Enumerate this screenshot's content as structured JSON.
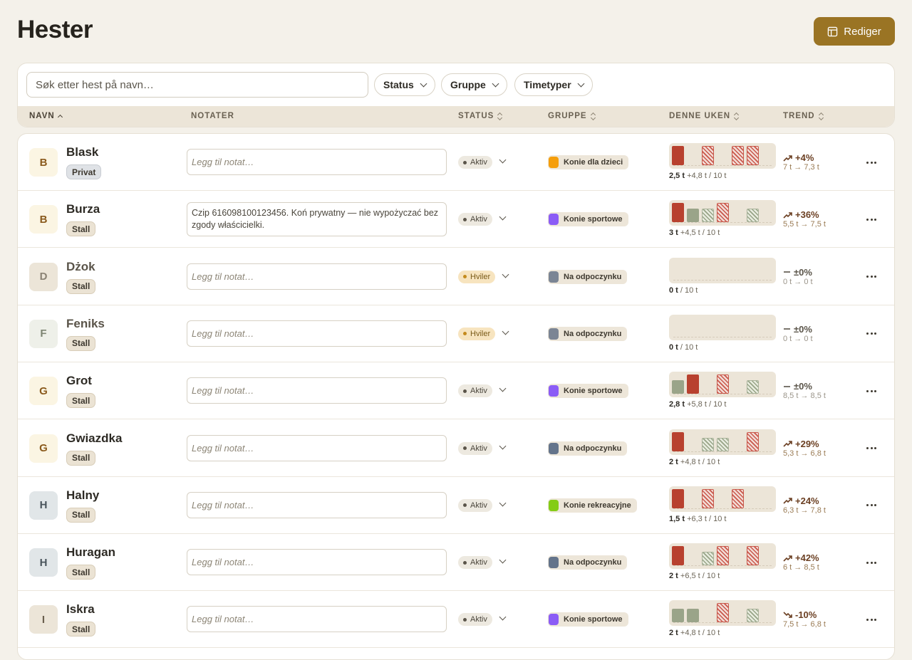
{
  "header": {
    "title": "Hester",
    "edit_label": "Rediger"
  },
  "filters": {
    "search_placeholder": "Søk etter hest på navn…",
    "status_label": "Status",
    "group_label": "Gruppe",
    "lesson_types_label": "Timetyper"
  },
  "table": {
    "columns": {
      "name": "NAVN",
      "notes": "NOTATER",
      "status": "STATUS",
      "group": "GRUPPE",
      "week": "DENNE UKEN",
      "trend": "TREND"
    },
    "note_placeholder": "Legg til notat…",
    "rows": [
      {
        "initial": "B",
        "name": "Blask",
        "tag": "Privat",
        "note": "",
        "status": "Aktiv",
        "group": "Konie dla dzieci",
        "group_color": "#f59e0b",
        "week_hours": "2,5 t",
        "week_extra": "+4,8 t",
        "week_cap": "/ 10 t",
        "trend": "+4%",
        "trend_range": "7 t → 7,3 t",
        "bars": [
          "solid",
          "",
          "plan",
          "",
          "plan",
          "plan"
        ],
        "trend_dir": "up"
      },
      {
        "initial": "B",
        "name": "Burza",
        "tag": "Stall",
        "note": "Czip 616098100123456. Koń prywatny — nie wypożyczać bez zgody właścicielki.",
        "status": "Aktiv",
        "group": "Konie sportowe",
        "group_color": "#8b5cf6",
        "week_hours": "3 t",
        "week_extra": "+4,5 t",
        "week_cap": "/ 10 t",
        "trend": "+36%",
        "trend_range": "5,5 t → 7,5 t",
        "bars": [
          "solid",
          "done",
          "plang",
          "plan",
          "",
          "plang"
        ],
        "trend_dir": "up"
      },
      {
        "initial": "D",
        "name": "Dżok",
        "tag": "Stall",
        "note": "",
        "status": "Hviler",
        "group": "Na odpoczynku",
        "group_color": "#7b8594",
        "week_hours": "0 t",
        "week_extra": "",
        "week_cap": "/ 10 t",
        "trend": "±0%",
        "trend_range": "0 t → 0 t",
        "bars": [
          "",
          "",
          "",
          "",
          "",
          ""
        ],
        "trend_dir": "flat"
      },
      {
        "initial": "F",
        "name": "Feniks",
        "tag": "Stall",
        "note": "",
        "status": "Hviler",
        "group": "Na odpoczynku",
        "group_color": "#7b8594",
        "week_hours": "0 t",
        "week_extra": "",
        "week_cap": "/ 10 t",
        "trend": "±0%",
        "trend_range": "0 t → 0 t",
        "bars": [
          "",
          "",
          "",
          "",
          "",
          ""
        ],
        "trend_dir": "flat"
      },
      {
        "initial": "G",
        "name": "Grot",
        "tag": "Stall",
        "note": "",
        "status": "Aktiv",
        "group": "Konie sportowe",
        "group_color": "#8b5cf6",
        "week_hours": "2,8 t",
        "week_extra": "+5,8 t",
        "week_cap": "/ 10 t",
        "trend": "±0%",
        "trend_range": "8,5 t → 8,5 t",
        "bars": [
          "done",
          "solid",
          "",
          "plan",
          "",
          "plang"
        ],
        "trend_dir": "flat"
      },
      {
        "initial": "G",
        "name": "Gwiazdka",
        "tag": "Stall",
        "note": "",
        "status": "Aktiv",
        "group": "Na odpoczynku",
        "group_color": "#64748b",
        "week_hours": "2 t",
        "week_extra": "+4,8 t",
        "week_cap": "/ 10 t",
        "trend": "+29%",
        "trend_range": "5,3 t → 6,8 t",
        "bars": [
          "solid",
          "",
          "plang",
          "plang",
          "",
          "plan"
        ],
        "trend_dir": "up"
      },
      {
        "initial": "H",
        "name": "Halny",
        "tag": "Stall",
        "note": "",
        "status": "Aktiv",
        "group": "Konie rekreacyjne",
        "group_color": "#84cc16",
        "week_hours": "1,5 t",
        "week_extra": "+6,3 t",
        "week_cap": "/ 10 t",
        "trend": "+24%",
        "trend_range": "6,3 t → 7,8 t",
        "bars": [
          "solid",
          "",
          "plan",
          "",
          "plan",
          ""
        ],
        "trend_dir": "up"
      },
      {
        "initial": "H",
        "name": "Huragan",
        "tag": "Stall",
        "note": "",
        "status": "Aktiv",
        "group": "Na odpoczynku",
        "group_color": "#64748b",
        "week_hours": "2 t",
        "week_extra": "+6,5 t",
        "week_cap": "/ 10 t",
        "trend": "+42%",
        "trend_range": "6 t → 8,5 t",
        "bars": [
          "solid",
          "",
          "plang",
          "plan",
          "",
          "plan"
        ],
        "trend_dir": "up"
      },
      {
        "initial": "I",
        "name": "Iskra",
        "tag": "Stall",
        "note": "",
        "status": "Aktiv",
        "group": "Konie sportowe",
        "group_color": "#8b5cf6",
        "week_hours": "2 t",
        "week_extra": "+4,8 t",
        "week_cap": "/ 10 t",
        "trend": "-10%",
        "trend_range": "7,5 t → 6,8 t",
        "bars": [
          "done",
          "done",
          "",
          "plan",
          "",
          "plang"
        ],
        "trend_dir": "down"
      }
    ]
  }
}
